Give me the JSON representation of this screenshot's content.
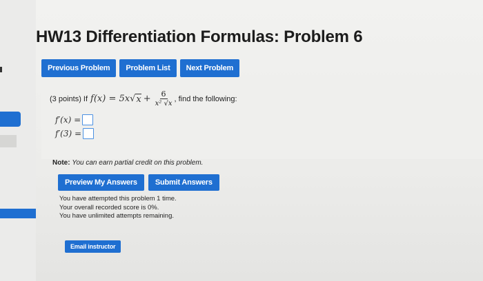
{
  "title": "HW13 Differentiation Formulas: Problem 6",
  "nav": {
    "previous": "Previous Problem",
    "list": "Problem List",
    "next": "Next Problem"
  },
  "problem": {
    "points": "(3 points) If",
    "fx": "f(x) = 5x",
    "sqrt_x": "x",
    "plus": "+",
    "frac_num": "6",
    "frac_den": "x² √x",
    "tail": ", find the following:"
  },
  "answers": [
    {
      "label": "f′(x) =",
      "value": ""
    },
    {
      "label": "f′(3) =",
      "value": ""
    }
  ],
  "note": {
    "bold": "Note:",
    "text": "You can earn partial credit on this problem."
  },
  "actions": {
    "preview": "Preview My Answers",
    "submit": "Submit Answers"
  },
  "status": {
    "attempts": "You have attempted this problem 1 time.",
    "score": "Your overall recorded score is 0%.",
    "remaining": "You have unlimited attempts remaining."
  },
  "email_button": "Email instructor",
  "colors": {
    "button_blue": "#1f6fd1",
    "input_border": "#4a90e2"
  }
}
